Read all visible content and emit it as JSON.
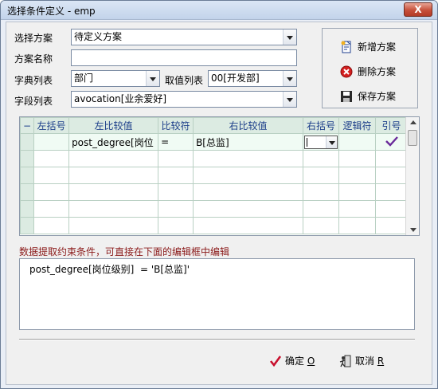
{
  "window": {
    "title": "选择条件定义 - emp",
    "close_glyph": "X"
  },
  "form": {
    "scheme_label": "选择方案",
    "scheme_value": "待定义方案",
    "scheme_name_label": "方案名称",
    "scheme_name_value": "",
    "dict_label": "字典列表",
    "dict_value": "部门",
    "value_list_label": "取值列表",
    "value_list_value": "00[开发部]",
    "field_list_label": "字段列表",
    "field_list_value": "avocation[业余爱好]"
  },
  "actions": {
    "add_scheme": "新增方案",
    "delete_scheme": "删除方案",
    "save_scheme": "保存方案"
  },
  "grid": {
    "indicator_header": "−",
    "columns": [
      "左括号",
      "左比较值",
      "比较符",
      "右比较值",
      "右括号",
      "逻辑符",
      "引号"
    ],
    "rows": [
      {
        "left_paren": "",
        "left_value": "post_degree[岗位",
        "op": "=",
        "right_value": "B[总监]",
        "right_paren": "",
        "logic": "",
        "quote_checked": true
      },
      {
        "left_paren": "",
        "left_value": "",
        "op": "",
        "right_value": "",
        "right_paren": "",
        "logic": "",
        "quote_checked": false
      },
      {
        "left_paren": "",
        "left_value": "",
        "op": "",
        "right_value": "",
        "right_paren": "",
        "logic": "",
        "quote_checked": false
      },
      {
        "left_paren": "",
        "left_value": "",
        "op": "",
        "right_value": "",
        "right_paren": "",
        "logic": "",
        "quote_checked": false
      },
      {
        "left_paren": "",
        "left_value": "",
        "op": "",
        "right_value": "",
        "right_paren": "",
        "logic": "",
        "quote_checked": false
      },
      {
        "left_paren": "",
        "left_value": "",
        "op": "",
        "right_value": "",
        "right_paren": "",
        "logic": "",
        "quote_checked": false
      }
    ]
  },
  "hint": "数据提取约束条件，可直接在下面的编辑框中编辑",
  "editor_text": "post_degree[岗位级别]  = 'B[总监]'",
  "footer": {
    "ok_label": "确定 ",
    "ok_key": "O",
    "cancel_label": "取消 ",
    "cancel_key": "R"
  },
  "colors": {
    "hint_text": "#8b1a1a",
    "grid_header_text": "#1d3f8a",
    "check_mark": "#6a2a9a",
    "ok_check": "#c8102e"
  }
}
